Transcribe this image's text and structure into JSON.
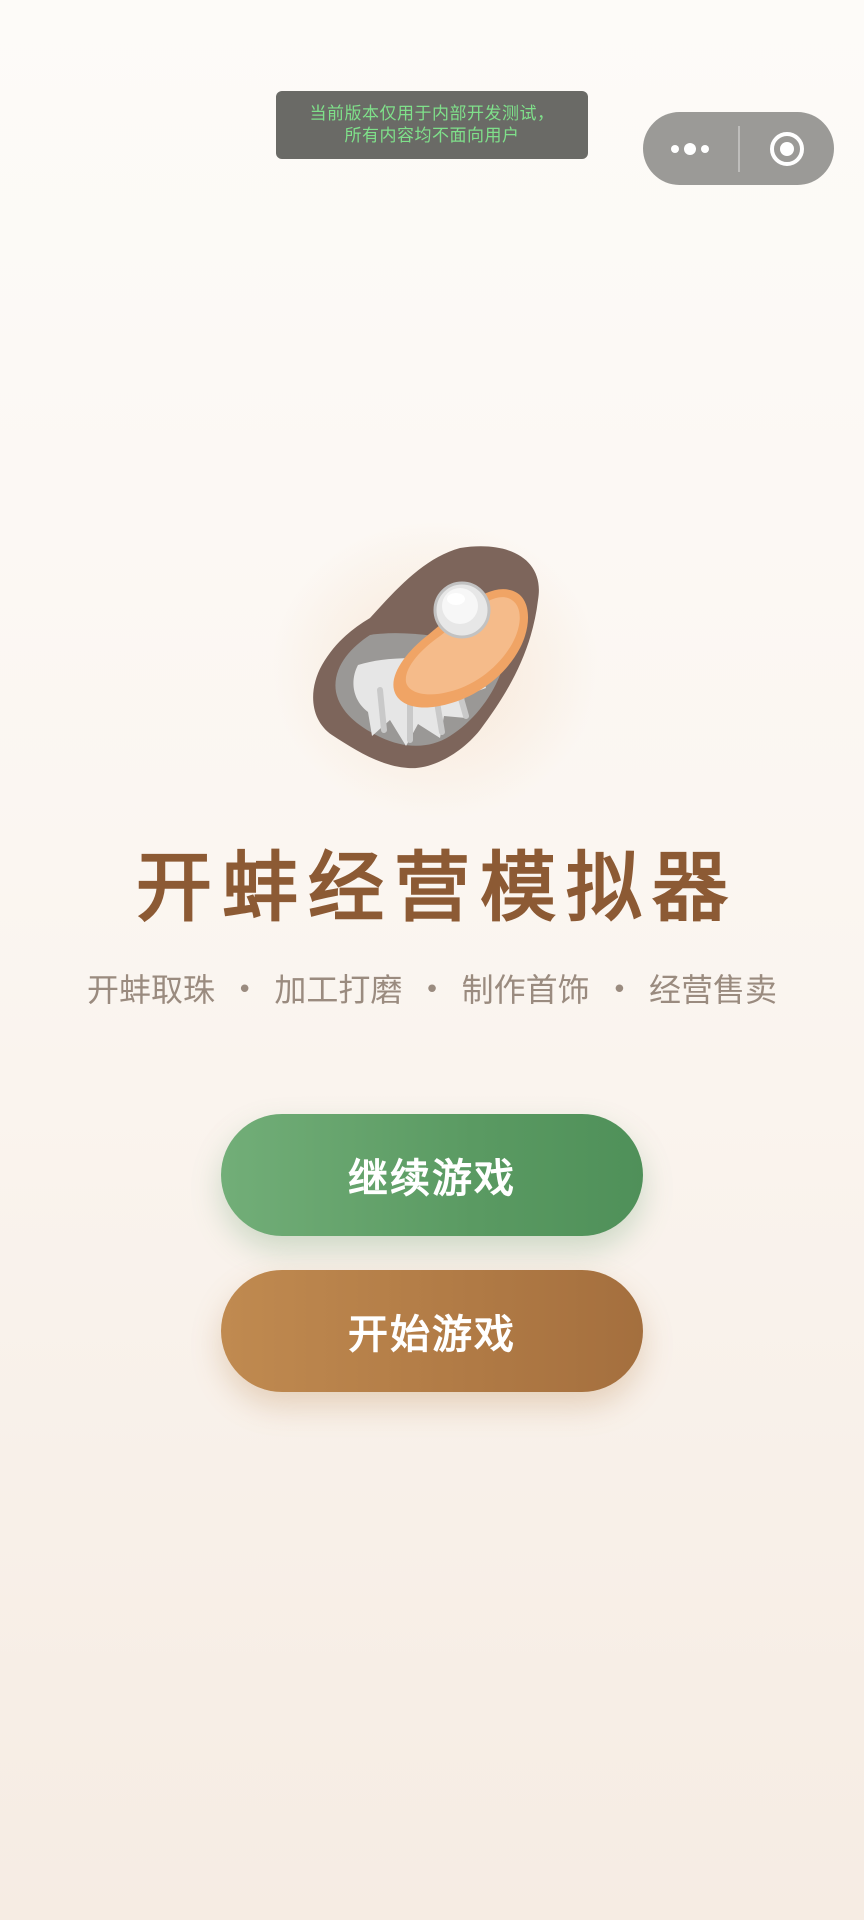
{
  "dev_notice": {
    "line1": "当前版本仅用于内部开发测试，",
    "line2": "所有内容均不面向用户"
  },
  "capsule": {
    "more_icon": "more-dots-icon",
    "close_icon": "target-circle-icon"
  },
  "logo": {
    "icon": "oyster-pearl-icon"
  },
  "title": "开蚌经营模拟器",
  "subtitle": {
    "items": [
      "开蚌取珠",
      "加工打磨",
      "制作首饰",
      "经营售卖"
    ],
    "separator": "•"
  },
  "buttons": {
    "continue_label": "继续游戏",
    "start_label": "开始游戏"
  },
  "colors": {
    "title": "#8c5a34",
    "continue_button": "#5a9a62",
    "start_button": "#b07a45",
    "notice_text": "#7fe08a"
  }
}
